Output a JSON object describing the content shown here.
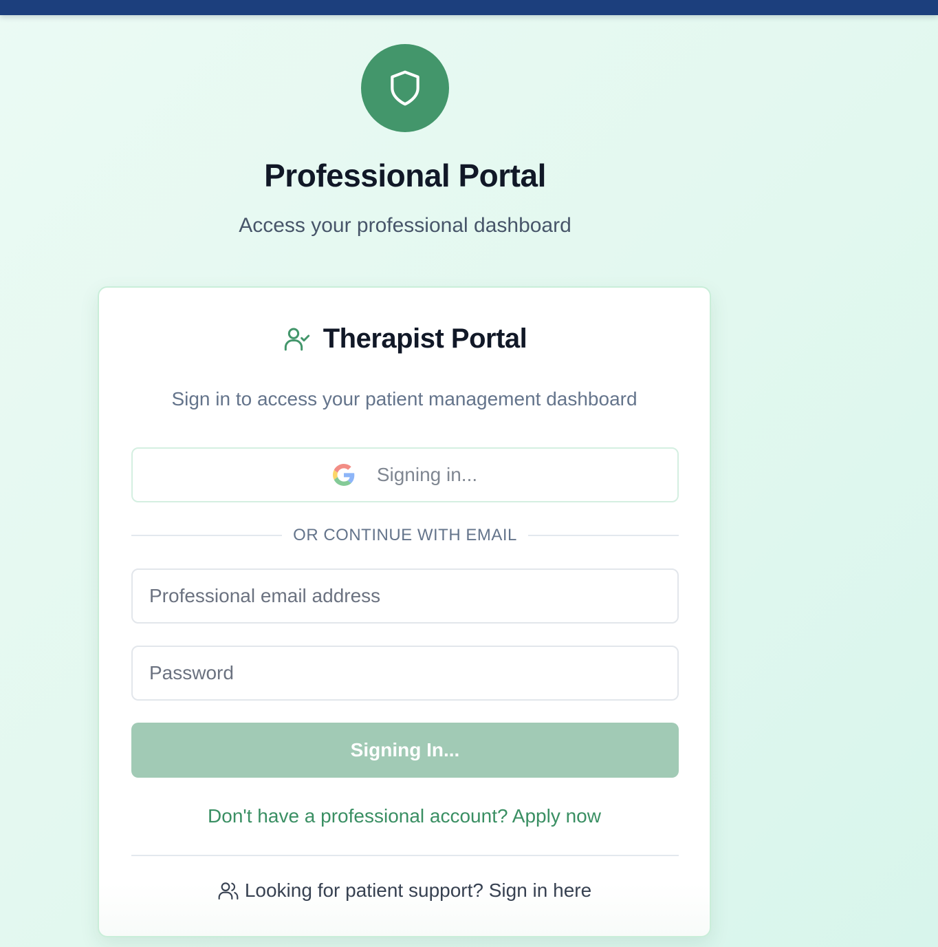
{
  "header": {
    "logo_icon": "shield-icon",
    "title": "Professional Portal",
    "subtitle": "Access your professional dashboard"
  },
  "card": {
    "icon": "user-check-icon",
    "title": "Therapist Portal",
    "description": "Sign in to access your patient management dashboard",
    "google_button": {
      "icon": "google-icon",
      "label": "Signing in..."
    },
    "divider_text": "OR CONTINUE WITH EMAIL",
    "email": {
      "value": "",
      "placeholder": "Professional email address"
    },
    "password": {
      "value": "",
      "placeholder": "Password"
    },
    "submit_label": "Signing In...",
    "apply_link": "Don't have a professional account? Apply now",
    "patient_link": {
      "icon": "users-icon",
      "label": "Looking for patient support? Sign in here"
    }
  },
  "colors": {
    "top_bar": "#1c3f7d",
    "brand_green": "#43966b",
    "submit_disabled": "#a1cab5",
    "link_green": "#3a8f63",
    "background_mint": "#e2f8ef"
  }
}
